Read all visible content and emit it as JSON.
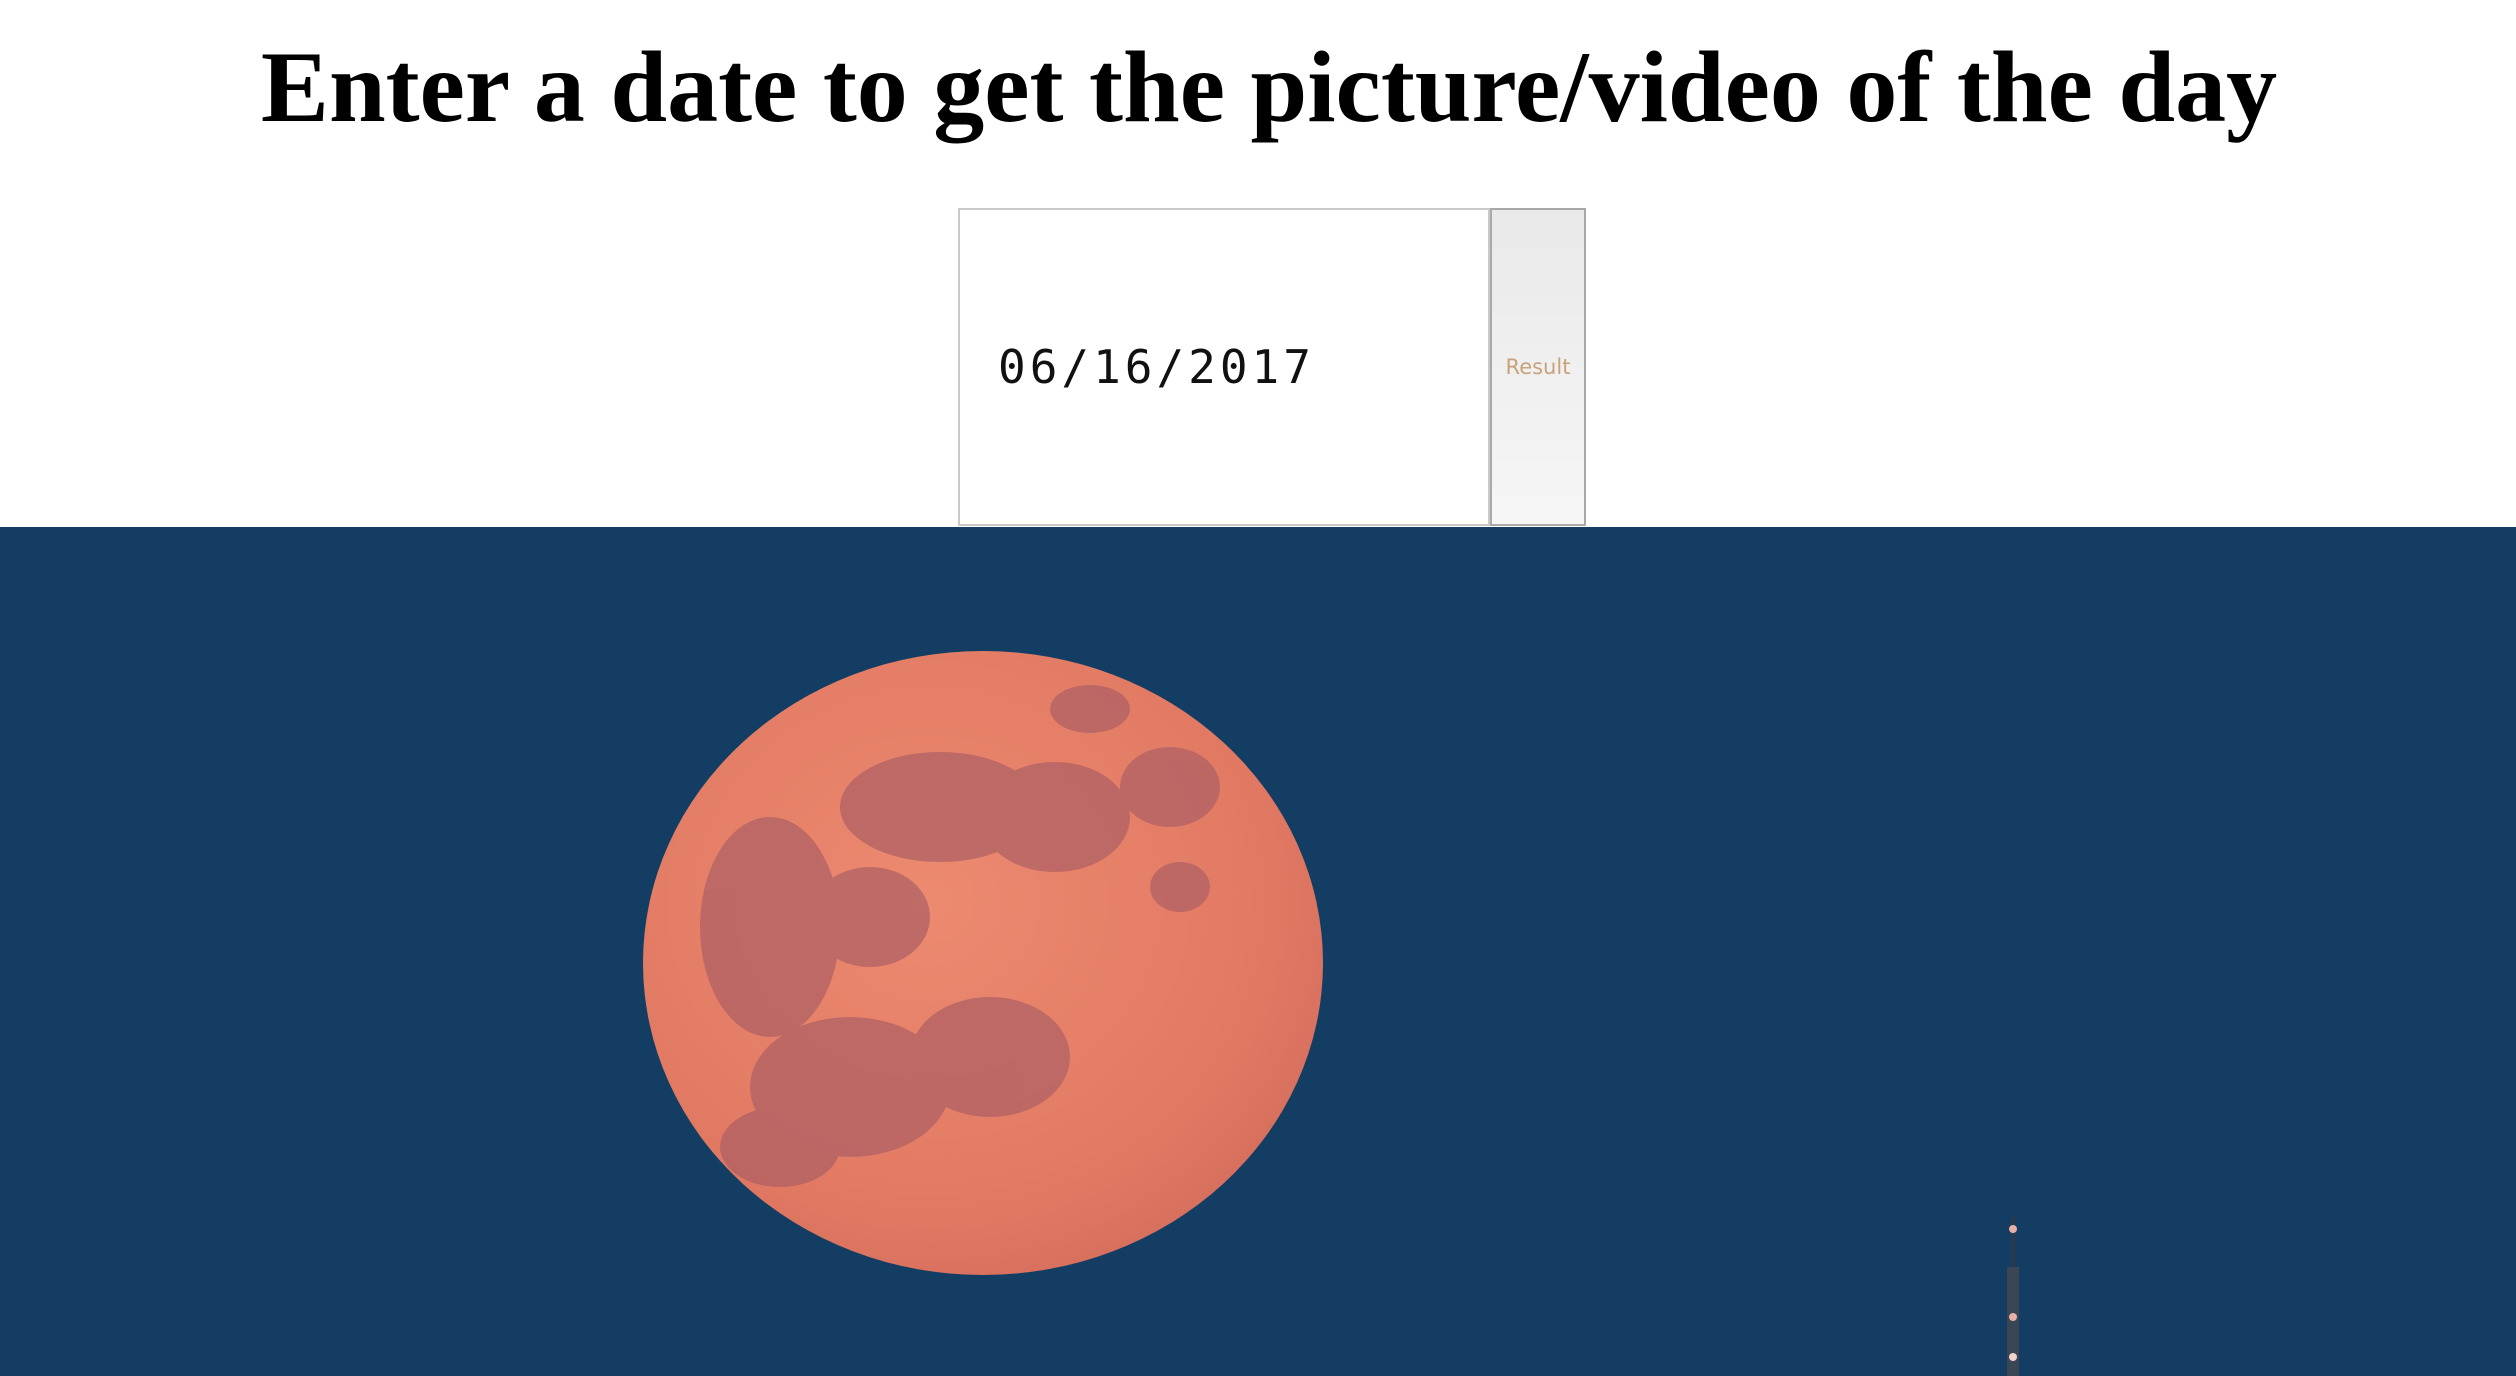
{
  "heading": "Enter a date to get the picture/video of the day",
  "date_input": {
    "value": "06/16/2017"
  },
  "result_button": {
    "label": "Result"
  },
  "picture": {
    "sky_color": "#143d63",
    "moon_color": "#e67f66",
    "moon_mare_color": "#b06165"
  }
}
